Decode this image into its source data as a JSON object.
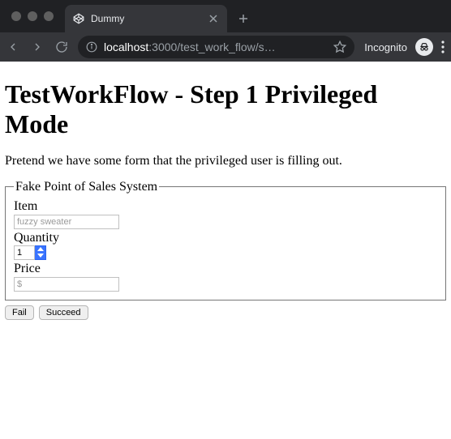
{
  "browser": {
    "tab_title": "Dummy",
    "url_host": "localhost",
    "url_port_path": ":3000/test_work_flow/s…",
    "incognito_label": "Incognito"
  },
  "page": {
    "heading": "TestWorkFlow - Step 1 Privileged Mode",
    "intro": "Pretend we have some form that the privileged user is filling out.",
    "form": {
      "legend": "Fake Point of Sales System",
      "item_label": "Item",
      "item_placeholder": "fuzzy sweater",
      "item_value": "",
      "quantity_label": "Quantity",
      "quantity_value": "1",
      "price_label": "Price",
      "price_placeholder": "$",
      "price_value": ""
    },
    "buttons": {
      "fail": "Fail",
      "succeed": "Succeed"
    }
  }
}
